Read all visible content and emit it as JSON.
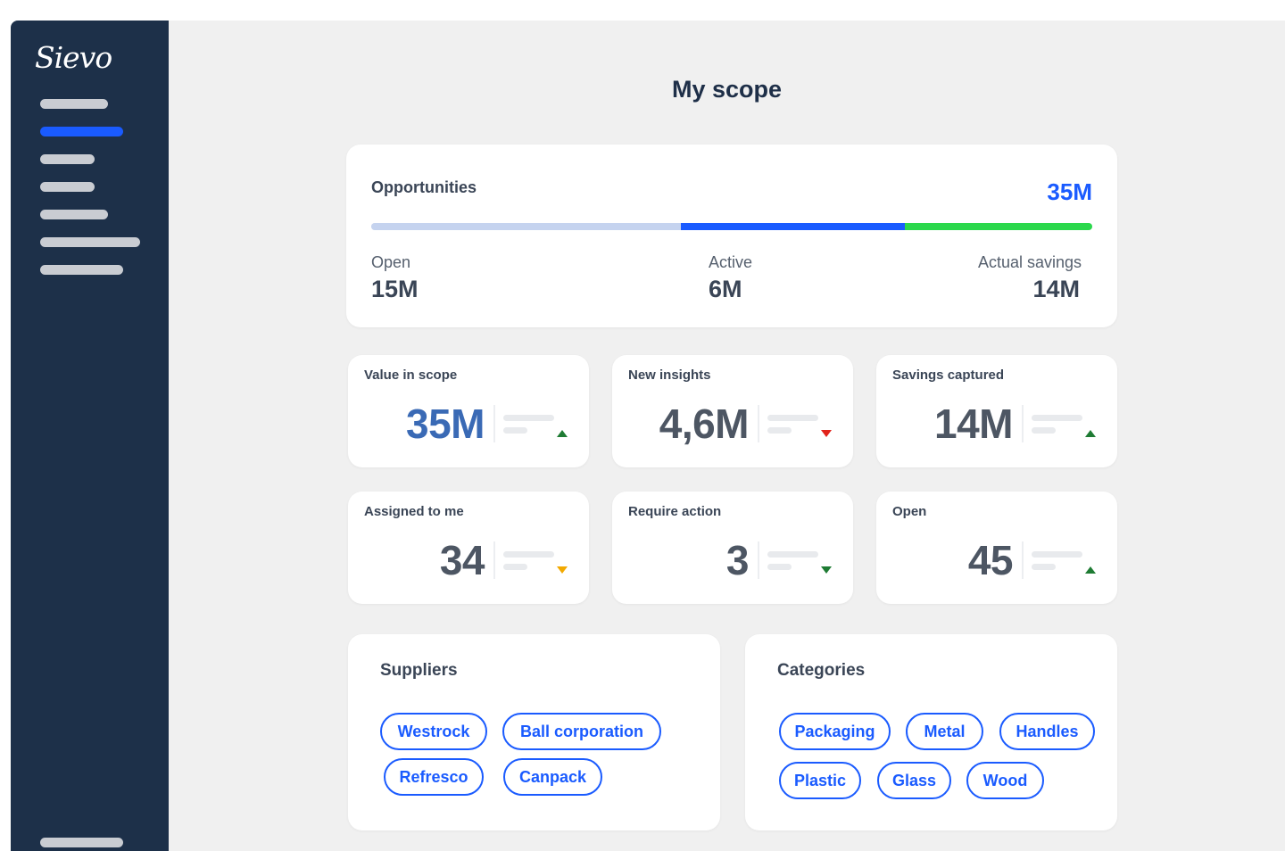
{
  "app": {
    "logo": "Sievo"
  },
  "sidebar": {
    "items": [
      {
        "name": "nav-item-1",
        "active": false
      },
      {
        "name": "nav-item-2",
        "active": true
      },
      {
        "name": "nav-item-3",
        "active": false
      },
      {
        "name": "nav-item-4",
        "active": false
      },
      {
        "name": "nav-item-5",
        "active": false
      },
      {
        "name": "nav-item-6",
        "active": false
      },
      {
        "name": "nav-item-7",
        "active": false
      }
    ]
  },
  "page": {
    "title": "My scope"
  },
  "opportunities": {
    "title": "Opportunities",
    "total": "35M",
    "segments": [
      {
        "label": "Open",
        "value": "15M",
        "share": 0.43,
        "color": "#c5d3ef"
      },
      {
        "label": "Active",
        "value": "6M",
        "share": 0.31,
        "color": "#1a5bff"
      },
      {
        "label": "Actual savings",
        "value": "14M",
        "share": 0.26,
        "color": "#2bd84c"
      }
    ]
  },
  "kpis": [
    {
      "label": "Value in scope",
      "value": "35M",
      "trend": "up",
      "trend_color": "#1e7b33"
    },
    {
      "label": "New insights",
      "value": "4,6M",
      "trend": "down",
      "trend_color": "#e1231b"
    },
    {
      "label": "Savings captured",
      "value": "14M",
      "trend": "up",
      "trend_color": "#1e7b33"
    },
    {
      "label": "Assigned to me",
      "value": "34",
      "trend": "down",
      "trend_color": "#f2a900"
    },
    {
      "label": "Require action",
      "value": "3",
      "trend": "down",
      "trend_color": "#1e7b33"
    },
    {
      "label": "Open",
      "value": "45",
      "trend": "up",
      "trend_color": "#1e7b33"
    }
  ],
  "suppliers": {
    "title": "Suppliers",
    "items": [
      "Westrock",
      "Ball corporation",
      "Refresco",
      "Canpack"
    ]
  },
  "categories": {
    "title": "Categories",
    "items": [
      "Packaging",
      "Metal",
      "Handles",
      "Plastic",
      "Glass",
      "Wood"
    ]
  },
  "colors": {
    "accent": "#1a5bff",
    "sidebar": "#1d3049",
    "background": "#f0f0f0"
  }
}
